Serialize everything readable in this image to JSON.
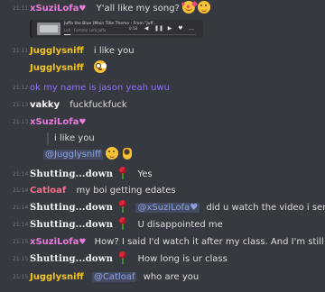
{
  "messages": [
    {
      "time": "21:11",
      "author": "xSuziLofa",
      "text": "Y'all like my song?"
    },
    {
      "time": "",
      "author": "",
      "text": ""
    },
    {
      "time": "21:11",
      "author": "Jugglysniff",
      "text": "i like you"
    },
    {
      "time": "",
      "author": "Jugglysniff",
      "text": ""
    },
    {
      "time": "21:12",
      "author": "",
      "text": "ok my name is jason yeah  uwu"
    },
    {
      "time": "21:13",
      "author": "vakky",
      "text": "fuckfuckfuck"
    },
    {
      "time": "21:13",
      "author": "xSuziLofa",
      "text": ""
    },
    {
      "time": "",
      "author": "",
      "text": "i like you"
    },
    {
      "time": "",
      "author": "",
      "mention": "@Jugglysniff"
    },
    {
      "time": "21:14",
      "author": "Shutting...down",
      "text": "Yes"
    },
    {
      "time": "21:14",
      "author": "Catloaf",
      "text": "my boi getting edates"
    },
    {
      "time": "21:14",
      "author": "Shutting...down",
      "mention": "@xSuziLofa♥",
      "text": "did u watch the video i send"
    },
    {
      "time": "21:14",
      "author": "Shutting...down",
      "text": "U disappointed me"
    },
    {
      "time": "21:15",
      "author": "xSuziLofa",
      "text": "How? I said I'd watch it after my class. And I'm still in"
    },
    {
      "time": "21:15",
      "author": "Shutting...down",
      "text": "How long is ur class"
    },
    {
      "time": "21:15",
      "author": "Jugglysniff",
      "mention": "@Catloaf",
      "text": "who are you"
    }
  ],
  "embed": {
    "title": "Juffa the Blue (Main Title Theme - From \"Juff...",
    "subtitle": "Lofi · Fortnite Lofa Juffa",
    "time": "0:18",
    "progress": 0.05,
    "controls": [
      "◀",
      "❚❚",
      "▶",
      "♥",
      "…"
    ]
  },
  "heart_glyph": "♥",
  "colors": {
    "background": "#36393f",
    "suzi": "#e67ad8",
    "jugglysniff": "#f0c420",
    "jason": "#8f74f2",
    "catloaf": "#f26e8a",
    "mention": "#8ea1e1"
  }
}
